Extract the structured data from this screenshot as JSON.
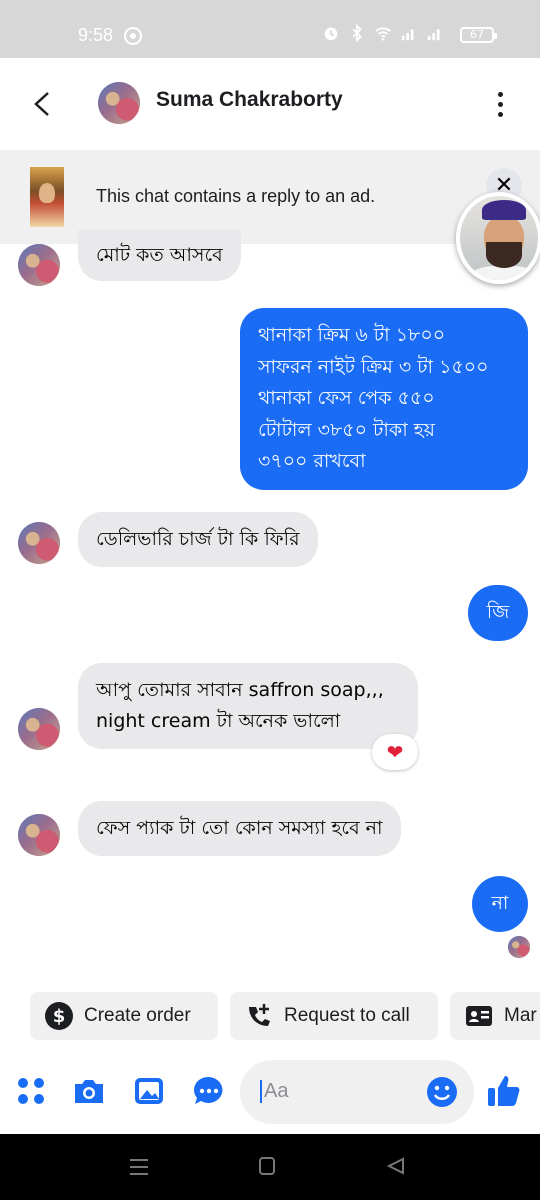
{
  "status_bar": {
    "time": "9:58",
    "battery": "67"
  },
  "header": {
    "contact_name": "Suma Chakraborty"
  },
  "ad_banner": {
    "text": "This chat contains a reply to an ad.",
    "close_label": "✕"
  },
  "messages": [
    {
      "dir": "in",
      "text": "মোট কত আসবে"
    },
    {
      "dir": "out",
      "text": "থানাকা ক্রিম ৬ টা ১৮০০\nসাফরন নাইট ক্রিম ৩ টা ১৫০০\nথানাকা ফেস পেক ৫৫০\nটোটাল ৩৮৫০ টাকা  হয়\n৩৭০০ রাখবো"
    },
    {
      "dir": "in",
      "text": "ডেলিভারি চার্জ টা কি ফিরি"
    },
    {
      "dir": "out",
      "text": "জি"
    },
    {
      "dir": "in",
      "text": "আপু তোমার সাবান saffron soap,,,\nnight cream টা অনেক ভালো",
      "reaction": "❤"
    },
    {
      "dir": "in",
      "text": "ফেস প্যাক টা তো কোন সমস্যা হবে না"
    },
    {
      "dir": "out",
      "text": "না"
    }
  ],
  "quick_actions": [
    {
      "label": "Create order",
      "icon": "dollar-icon"
    },
    {
      "label": "Request to call",
      "icon": "phone-plus-icon"
    },
    {
      "label": "Mar",
      "icon": "contact-card-icon"
    }
  ],
  "composer": {
    "placeholder": "Aa"
  },
  "colors": {
    "accent": "#1a6cf5",
    "incoming_bubble": "#e9e9eb",
    "statusbar": "#d7d7d8"
  }
}
